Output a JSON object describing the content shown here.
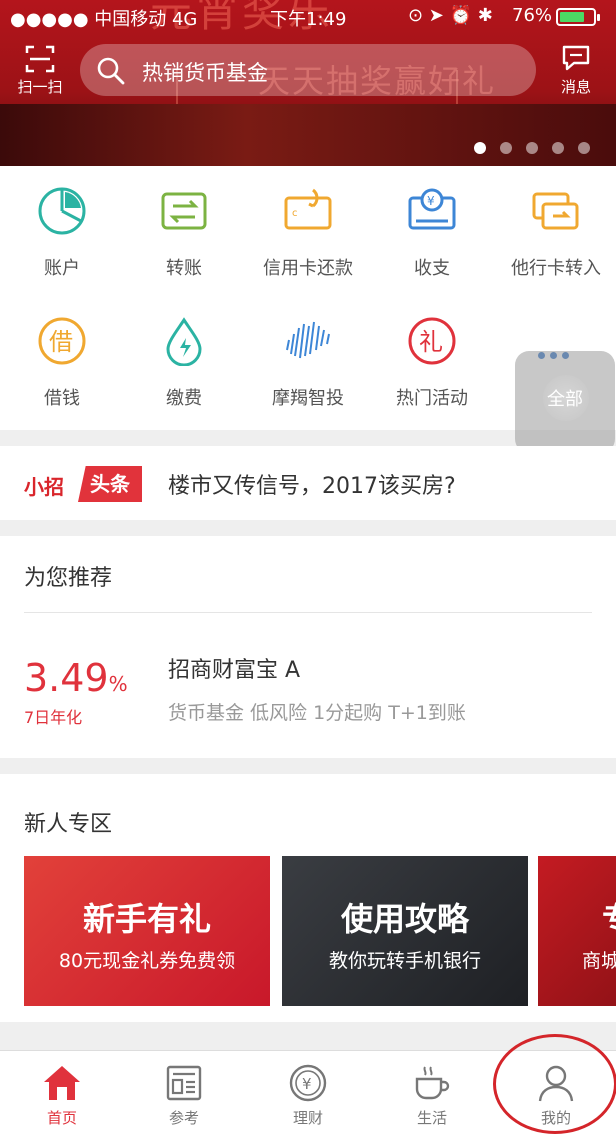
{
  "status_bar": {
    "carrier": "●●●●● 中国移动 4G",
    "time": "下午1:49",
    "icons": "⊙ ➤ ⏰ ✱",
    "battery_pct": "76%",
    "battery_level": 0.76
  },
  "header": {
    "scan_label": "扫一扫",
    "search_placeholder": "热销货币基金",
    "message_label": "消息"
  },
  "banner": {
    "slogan_top": "元宵奖乐",
    "slogan": "天天抽奖赢好礼",
    "page_count": 5,
    "active_page": 0
  },
  "quick_grid": [
    {
      "label": "账户",
      "icon": "pie-chart-icon"
    },
    {
      "label": "转账",
      "icon": "transfer-icon"
    },
    {
      "label": "信用卡还款",
      "icon": "card-repay-icon"
    },
    {
      "label": "收支",
      "icon": "yuan-bill-icon"
    },
    {
      "label": "他行卡转入",
      "icon": "other-bank-card-icon"
    },
    {
      "label": "借钱",
      "icon": "borrow-icon"
    },
    {
      "label": "缴费",
      "icon": "water-bolt-icon"
    },
    {
      "label": "摩羯智投",
      "icon": "wave-lines-icon"
    },
    {
      "label": "热门活动",
      "icon": "gift-icon"
    },
    {
      "label": "全部",
      "icon": "more-dots-icon"
    }
  ],
  "headline": {
    "badge_a": "小招",
    "badge_b": "头条",
    "text": "楼市又传信号，2017该买房?"
  },
  "recommend": {
    "title": "为您推荐",
    "rate": "3.49",
    "rate_unit": "%",
    "rate_label": "7日年化",
    "product": "招商财富宝 A",
    "description": "货币基金 低风险 1分起购 T+1到账"
  },
  "newcomer": {
    "title": "新人专区",
    "cards": [
      {
        "title": "新手有礼",
        "subtitle": "80元现金礼券免费领"
      },
      {
        "title": "使用攻略",
        "subtitle": "教你玩转手机银行"
      },
      {
        "title": "专",
        "subtitle": "商城"
      }
    ]
  },
  "tabbar": [
    {
      "label": "首页",
      "icon": "home-icon",
      "active": true
    },
    {
      "label": "参考",
      "icon": "news-icon",
      "active": false
    },
    {
      "label": "理财",
      "icon": "yuan-coin-icon",
      "active": false
    },
    {
      "label": "生活",
      "icon": "coffee-cup-icon",
      "active": false
    },
    {
      "label": "我的",
      "icon": "person-icon",
      "active": false
    }
  ],
  "colors": {
    "brand_red": "#e0323c",
    "banner_red": "#b4151c",
    "annotation_circle": "#d4252a"
  }
}
